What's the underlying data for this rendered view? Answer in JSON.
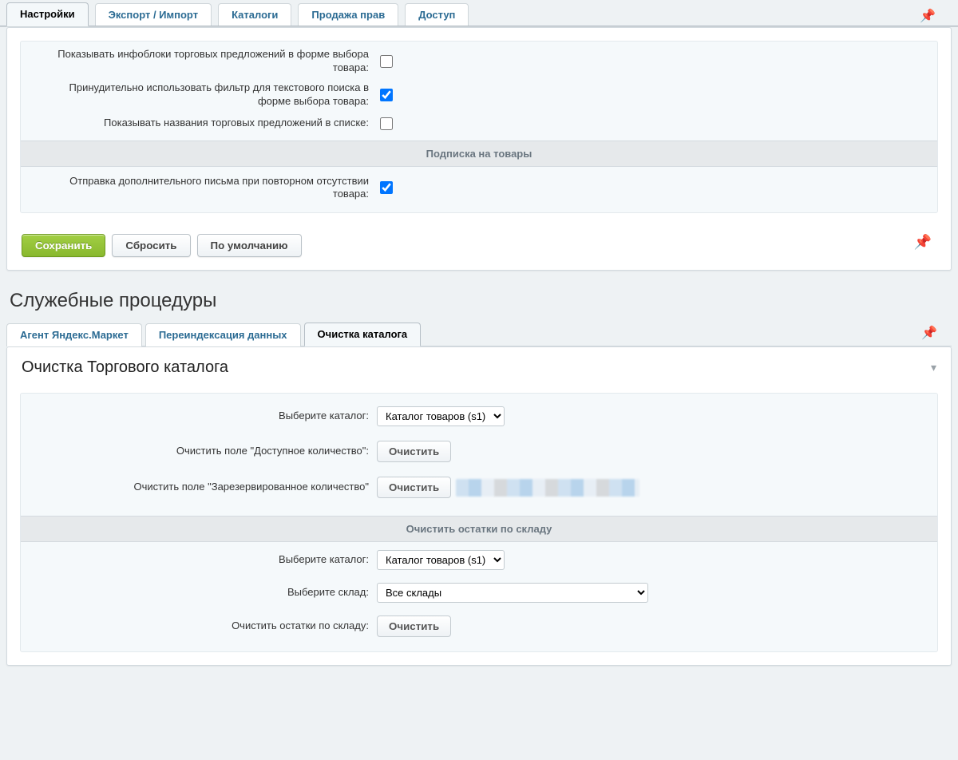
{
  "topTabs": {
    "t0": "Настройки",
    "t1": "Экспорт / Импорт",
    "t2": "Каталоги",
    "t3": "Продажа прав",
    "t4": "Доступ"
  },
  "form": {
    "row1": "Показывать инфоблоки торговых предложений в форме выбора товара:",
    "row2": "Принудительно использовать фильтр для текстового поиска в форме выбора товара:",
    "row3": "Показывать названия торговых предложений в списке:",
    "band_subscribe": "Подписка на товары",
    "row4": "Отправка дополнительного письма при повторном отсутствии товара:"
  },
  "buttons": {
    "save": "Сохранить",
    "reset": "Сбросить",
    "default": "По умолчанию"
  },
  "section_heading": "Служебные процедуры",
  "procTabs": {
    "t0": "Агент Яндекс.Маркет",
    "t1": "Переиндексация данных",
    "t2": "Очистка каталога"
  },
  "cleanup": {
    "heading": "Очистка Торгового каталога",
    "select_catalog_label": "Выберите каталог:",
    "catalog_option": "Каталог товаров (s1)",
    "clear_available_label": "Очистить поле \"Доступное количество\":",
    "clear_reserved_label": "Очистить поле \"Зарезервированное количество\"",
    "clear_btn": "Очистить",
    "band_stock": "Очистить остатки по складу",
    "select_store_label": "Выберите склад:",
    "store_option": "Все склады",
    "clear_stock_label": "Очистить остатки по складу:"
  }
}
